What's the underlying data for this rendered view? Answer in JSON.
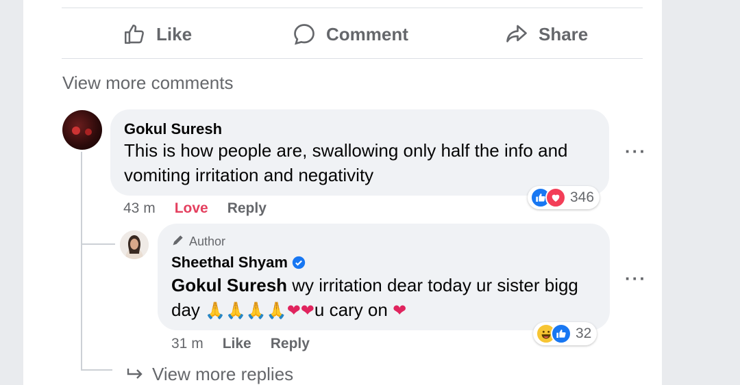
{
  "actions": {
    "like_label": "Like",
    "comment_label": "Comment",
    "share_label": "Share"
  },
  "view_more_comments": "View more comments",
  "comment": {
    "author": "Gokul Suresh",
    "text_line1": "This is how people are, swallowing only half the info and",
    "text_line2": "vomiting irritation and negativity",
    "time": "43 m",
    "reaction_link": "Love",
    "reply_link": "Reply",
    "reaction_count": "346",
    "reaction_icons": [
      "like-icon",
      "love-icon"
    ]
  },
  "reply": {
    "badge_label": "Author",
    "author": "Sheethal Shyam",
    "verified": true,
    "mention": "Gokul Suresh",
    "text_line1_rest": " wy irritation dear today ur sister bigg",
    "text_line2_start": "day ",
    "emoji_prayers": "🙏🙏🙏🙏",
    "emoji_hearts": "❤❤",
    "text_line2_mid": "u cary on ",
    "emoji_heart_end": "❤",
    "time": "31 m",
    "like_link": "Like",
    "reply_link": "Reply",
    "reaction_count": "32",
    "reaction_icons": [
      "haha-icon",
      "like-icon"
    ]
  },
  "view_more_replies": "View more replies",
  "colors": {
    "love": "#e4405f",
    "like_blue": "#1877f2",
    "meta_gray": "#65676b",
    "bubble": "#f0f2f5"
  }
}
